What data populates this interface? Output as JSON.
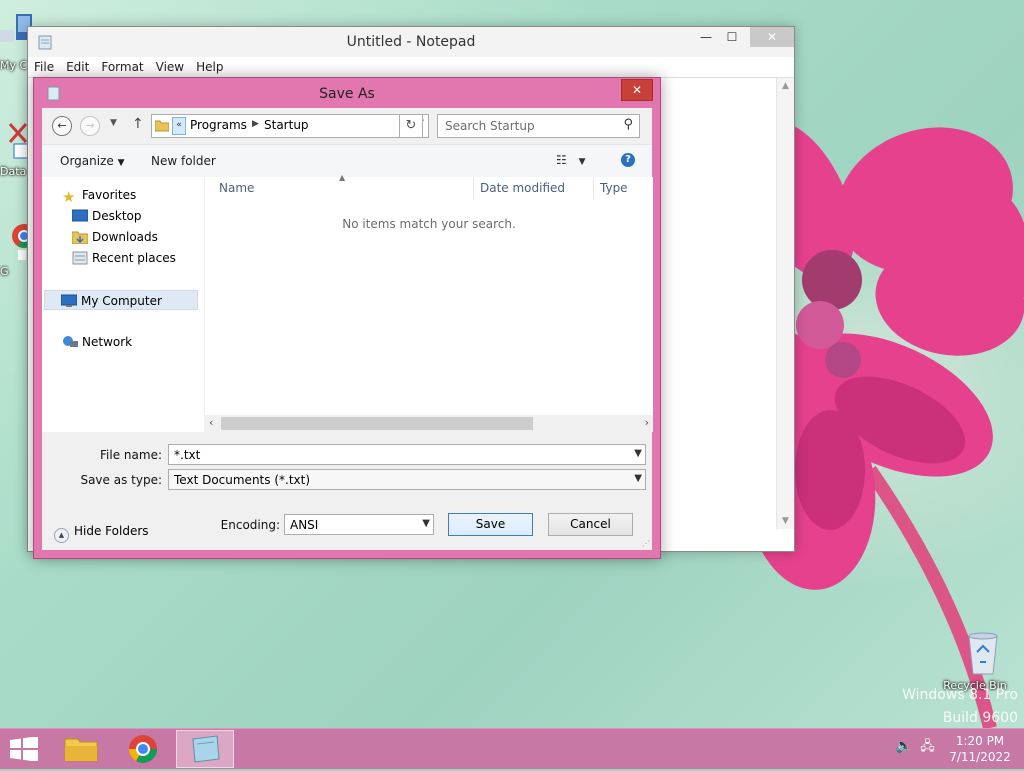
{
  "desktop": {
    "icons": [
      {
        "label": "My C",
        "icon": "my-computer-icon"
      },
      {
        "label": "Data",
        "icon": "data-shortcut-icon"
      },
      {
        "label": "G",
        "icon": "chrome-shortcut-icon"
      }
    ],
    "recycle_bin_label": "Recycle Bin",
    "watermark_line1": "Windows 8.1 Pro",
    "watermark_line2": "Build 9600"
  },
  "notepad": {
    "title": "Untitled - Notepad",
    "menu": [
      "File",
      "Edit",
      "Format",
      "View",
      "Help"
    ],
    "caption_minimize": "—",
    "caption_maximize": "☐",
    "caption_close": "✕"
  },
  "save_as": {
    "title": "Save As",
    "close": "✕",
    "breadcrumb": [
      "Programs",
      "Startup"
    ],
    "breadcrumb_overflow": "«",
    "search_placeholder": "Search Startup",
    "commands": {
      "organize": "Organize",
      "new_folder": "New folder"
    },
    "nav": {
      "favorites": "Favorites",
      "desktop": "Desktop",
      "downloads": "Downloads",
      "recent": "Recent places",
      "my_computer": "My Computer",
      "network": "Network"
    },
    "columns": {
      "name": "Name",
      "date": "Date modified",
      "type": "Type"
    },
    "empty_message": "No items match your search.",
    "file_name_label": "File name:",
    "file_name_value": "*.txt",
    "save_type_label": "Save as type:",
    "save_type_value": "Text Documents (*.txt)",
    "hide_folders": "Hide Folders",
    "encoding_label": "Encoding:",
    "encoding_value": "ANSI",
    "save": "Save",
    "cancel": "Cancel"
  },
  "taskbar": {
    "time": "1:20 PM",
    "date": "7/11/2022"
  },
  "colors": {
    "dialog_frame": "#e277b0",
    "taskbar": "#c878a5",
    "close_red": "#c7413a",
    "selection": "#dfe9f5"
  }
}
